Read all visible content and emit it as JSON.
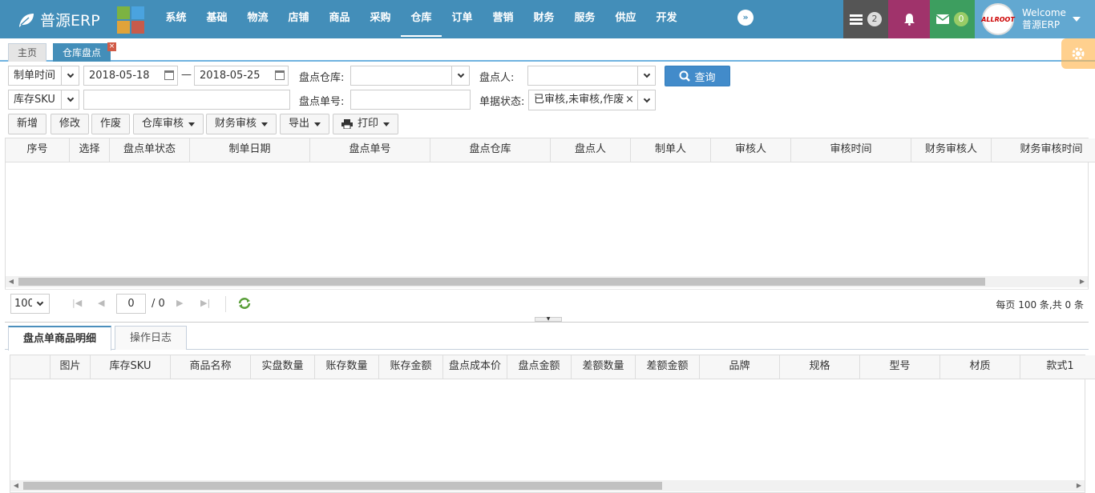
{
  "app": {
    "title": "普源ERP"
  },
  "nav": [
    "系统",
    "基础",
    "物流",
    "店铺",
    "商品",
    "采购",
    "仓库",
    "订单",
    "营销",
    "财务",
    "服务",
    "供应",
    "开发"
  ],
  "nav_active": "仓库",
  "toolbar": {
    "tasks_count": "2",
    "messages_count": "0",
    "welcome": "Welcome",
    "username": "普源ERP",
    "avatar_text": "ALLROOT"
  },
  "page_tabs": [
    {
      "label": "主页"
    },
    {
      "label": "仓库盘点"
    }
  ],
  "filters": {
    "date_type": "制单时间",
    "date_from": "2018-05-18",
    "date_sep": "—",
    "date_to": "2018-05-25",
    "warehouse_label": "盘点仓库:",
    "warehouse_value": "",
    "counter_label": "盘点人:",
    "counter_value": "",
    "query_button": "查询",
    "sku_type": "库存SKU",
    "sku_value": "",
    "order_no_label": "盘点单号:",
    "order_no_value": "",
    "status_label": "单据状态:",
    "status_value": "已审核,未审核,作废"
  },
  "actions": [
    "新增",
    "修改",
    "作废",
    "仓库审核",
    "财务审核",
    "导出",
    "打印"
  ],
  "main_grid": {
    "columns": [
      "序号",
      "选择",
      "盘点单状态",
      "制单日期",
      "盘点单号",
      "盘点仓库",
      "盘点人",
      "制单人",
      "审核人",
      "审核时间",
      "财务审核人",
      "财务审核时间"
    ],
    "rows": []
  },
  "pager": {
    "page_size": "100",
    "current_page": "0",
    "total_pages": "/ 0",
    "summary": "每页 100 条,共 0 条"
  },
  "detail_tabs": [
    "盘点单商品明细",
    "操作日志"
  ],
  "detail_grid": {
    "columns": [
      "",
      "图片",
      "库存SKU",
      "商品名称",
      "实盘数量",
      "账存数量",
      "账存金额",
      "盘点成本价",
      "盘点金额",
      "差额数量",
      "差额金额",
      "品牌",
      "规格",
      "型号",
      "材质",
      "款式1"
    ],
    "rows": []
  },
  "colors": {
    "header": "#438eb9",
    "user_block": "#62a8d1",
    "bell_block": "#a0336b",
    "mail_block": "#3d9e5f",
    "tasks_block": "#555555",
    "primary_button": "#428bca"
  }
}
